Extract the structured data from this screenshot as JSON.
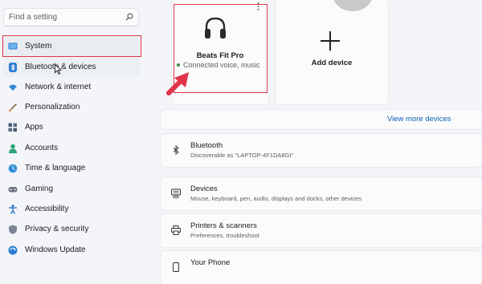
{
  "search": {
    "placeholder": "Find a setting",
    "icon": "search-icon"
  },
  "sidebar": {
    "items": [
      {
        "label": "System",
        "icon": "system-icon",
        "state": "selected"
      },
      {
        "label": "Bluetooth & devices",
        "icon": "bluetooth-icon",
        "state": "hover"
      },
      {
        "label": "Network & internet",
        "icon": "wifi-icon"
      },
      {
        "label": "Personalization",
        "icon": "brush-icon"
      },
      {
        "label": "Apps",
        "icon": "apps-icon"
      },
      {
        "label": "Accounts",
        "icon": "account-icon"
      },
      {
        "label": "Time & language",
        "icon": "globe-clock-icon"
      },
      {
        "label": "Gaming",
        "icon": "gamepad-icon"
      },
      {
        "label": "Accessibility",
        "icon": "accessibility-icon"
      },
      {
        "label": "Privacy & security",
        "icon": "shield-icon"
      },
      {
        "label": "Windows Update",
        "icon": "update-icon"
      }
    ]
  },
  "devices": {
    "paired": {
      "name": "Beats Fit Pro",
      "status": "Connected voice, music",
      "icon": "headphones-icon",
      "status_color": "#2f8a3c"
    },
    "add_label": "Add device"
  },
  "view_more": "View more devices",
  "rows": [
    {
      "title": "Bluetooth",
      "subtitle": "Discoverable as \"LAPTOP-4F1DA8GI\"",
      "icon": "bluetooth-icon"
    },
    {
      "title": "Devices",
      "subtitle": "Mouse, keyboard, pen, audio, displays and docks, other devices",
      "icon": "devices-icon"
    },
    {
      "title": "Printers & scanners",
      "subtitle": "Preferences, troubleshoot",
      "icon": "printer-icon"
    },
    {
      "title": "Your Phone",
      "subtitle": "",
      "icon": "phone-icon"
    }
  ],
  "colors": {
    "accent": "#0a5fb4",
    "highlight": "#e0344a",
    "background": "#f3f5f9"
  }
}
